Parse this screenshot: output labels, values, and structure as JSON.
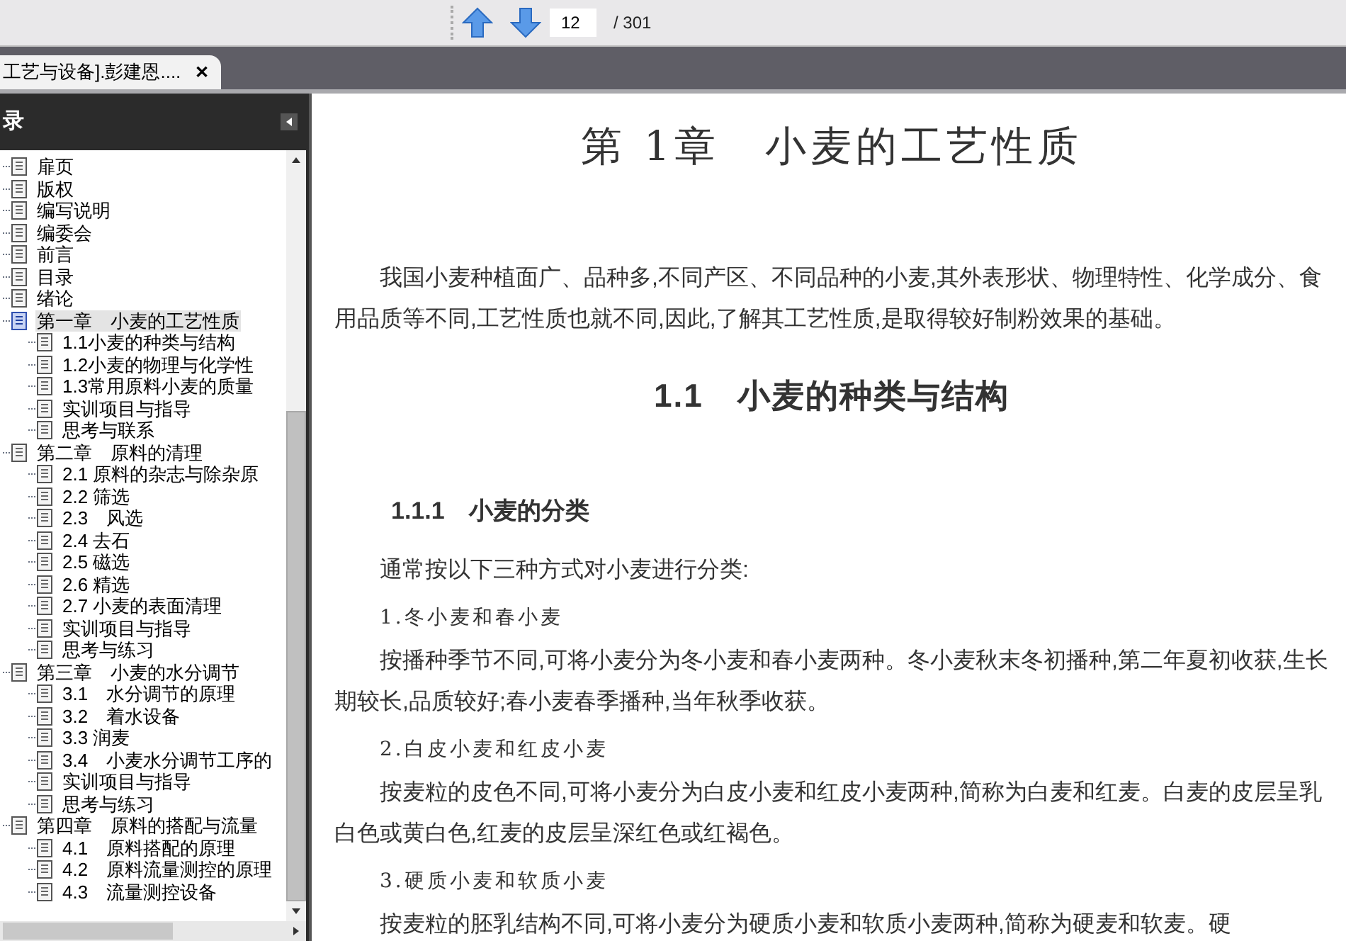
{
  "toolbar": {
    "page_input": {
      "value": "12"
    },
    "page_total": "/ 301"
  },
  "tabs": [
    {
      "label": "工艺与设备].彭建恩....",
      "selected": true,
      "close": "✕"
    }
  ],
  "sidebar": {
    "title": "录",
    "items": [
      {
        "label": "扉页",
        "selected": false
      },
      {
        "label": "版权",
        "selected": false
      },
      {
        "label": "编写说明",
        "selected": false
      },
      {
        "label": "  编委会",
        "selected": false
      },
      {
        "label": "前言",
        "selected": false
      },
      {
        "label": "目录",
        "selected": false
      },
      {
        "label": "绪论",
        "selected": false
      },
      {
        "label": "第一章　小麦的工艺性质",
        "selected": true,
        "children": [
          {
            "label": "1.1小麦的种类与结构",
            "selected": false
          },
          {
            "label": "1.2小麦的物理与化学性",
            "selected": false
          },
          {
            "label": "1.3常用原料小麦的质量",
            "selected": false
          },
          {
            "label": "实训项目与指导",
            "selected": false
          },
          {
            "label": "思考与联系",
            "selected": false
          }
        ]
      },
      {
        "label": "第二章　原料的清理",
        "selected": false,
        "children": [
          {
            "label": "2.1 原料的杂志与除杂原",
            "selected": false
          },
          {
            "label": "2.2 筛选",
            "selected": false
          },
          {
            "label": "2.3　风选",
            "selected": false
          },
          {
            "label": "2.4 去石",
            "selected": false
          },
          {
            "label": "2.5 磁选",
            "selected": false
          },
          {
            "label": "2.6 精选",
            "selected": false
          },
          {
            "label": "2.7 小麦的表面清理",
            "selected": false
          },
          {
            "label": "实训项目与指导",
            "selected": false
          },
          {
            "label": "思考与练习",
            "selected": false
          }
        ]
      },
      {
        "label": "第三章　小麦的水分调节",
        "selected": false,
        "children": [
          {
            "label": "3.1　水分调节的原理",
            "selected": false
          },
          {
            "label": "3.2　着水设备",
            "selected": false
          },
          {
            "label": "3.3 润麦",
            "selected": false
          },
          {
            "label": "3.4　小麦水分调节工序的",
            "selected": false
          },
          {
            "label": "实训项目与指导",
            "selected": false
          },
          {
            "label": "思考与练习",
            "selected": false
          }
        ]
      },
      {
        "label": "第四章　原料的搭配与流量",
        "selected": false,
        "children": [
          {
            "label": "4.1　原料搭配的原理",
            "selected": false
          },
          {
            "label": "4.2　原料流量测控的原理",
            "selected": false
          },
          {
            "label": "4.3　流量测控设备",
            "selected": false
          }
        ]
      }
    ]
  },
  "document": {
    "blocks": [
      {
        "kind": "chapter",
        "text": "第 1章　小麦的工艺性质"
      },
      {
        "kind": "para",
        "text": "我国小麦种植面广、品种多,不同产区、不同品种的小麦,其外表形状、物理特性、化学成分、食用品质等不同,工艺性质也就不同,因此,了解其工艺性质,是取得较好制粉效果的基础。"
      },
      {
        "kind": "section",
        "text": "1.1　小麦的种类与结构"
      },
      {
        "kind": "subsection",
        "text": "1.1.1　小麦的分类"
      },
      {
        "kind": "para",
        "text": "通常按以下三种方式对小麦进行分类:"
      },
      {
        "kind": "item",
        "text": "1.冬小麦和春小麦"
      },
      {
        "kind": "para",
        "text": "按播种季节不同,可将小麦分为冬小麦和春小麦两种。冬小麦秋末冬初播种,第二年夏初收获,生长期较长,品质较好;春小麦春季播种,当年秋季收获。"
      },
      {
        "kind": "item",
        "text": "2.白皮小麦和红皮小麦"
      },
      {
        "kind": "para",
        "text": "按麦粒的皮色不同,可将小麦分为白皮小麦和红皮小麦两种,简称为白麦和红麦。白麦的皮层呈乳白色或黄白色,红麦的皮层呈深红色或红褐色。"
      },
      {
        "kind": "item",
        "text": "3.硬质小麦和软质小麦"
      },
      {
        "kind": "para",
        "text": "按麦粒的胚乳结构不同,可将小麦分为硬质小麦和软质小麦两种,简称为硬麦和软麦。硬"
      }
    ]
  }
}
